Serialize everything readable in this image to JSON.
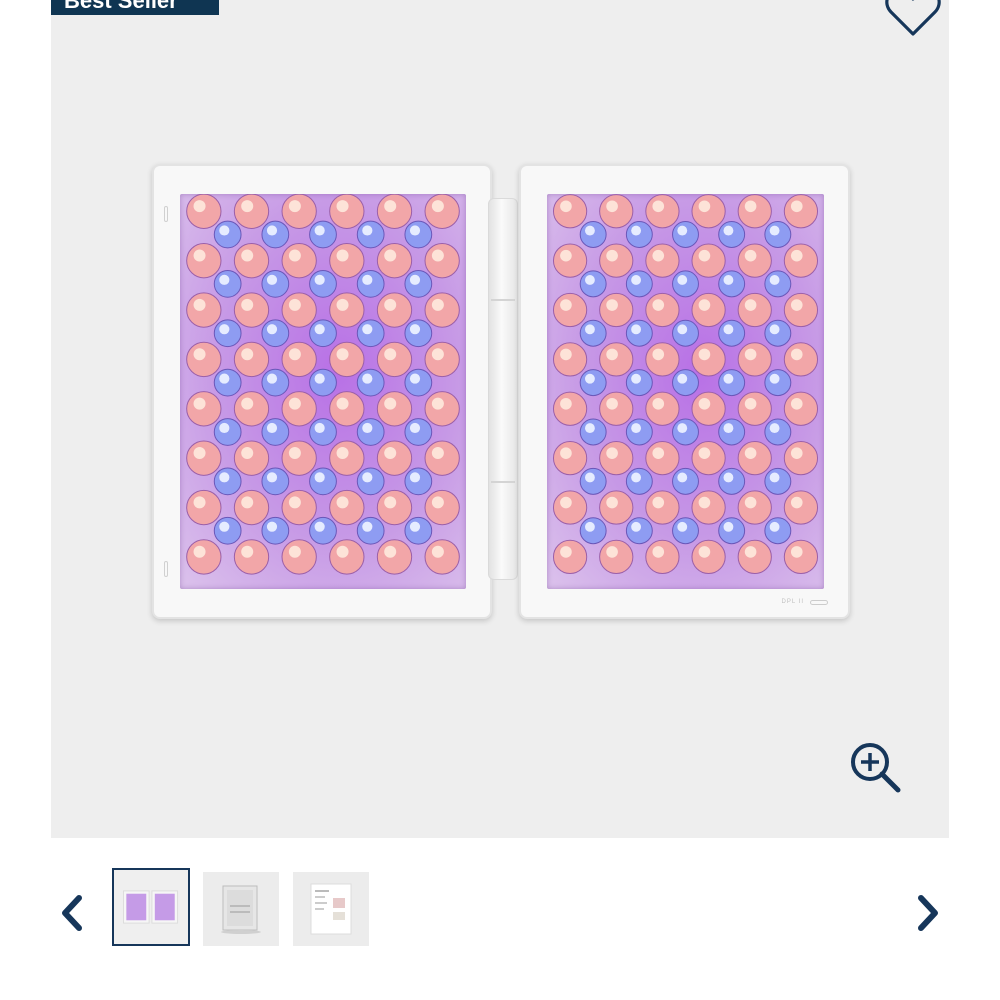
{
  "badge": {
    "label": "Best Seller"
  },
  "icons": {
    "wishlist": "heart-outline-icon",
    "zoom": "zoom-in-icon",
    "prev": "chevron-left-icon",
    "next": "chevron-right-icon"
  },
  "colors": {
    "brand_navy": "#0f3552",
    "gallery_bg": "#eeeeee",
    "led_red": "#f2a6a8",
    "led_blue": "#8e9cf2"
  },
  "product_image": {
    "device_label": "DPL II"
  },
  "thumbnails": [
    {
      "selected": true
    },
    {
      "selected": false
    },
    {
      "selected": false
    }
  ]
}
